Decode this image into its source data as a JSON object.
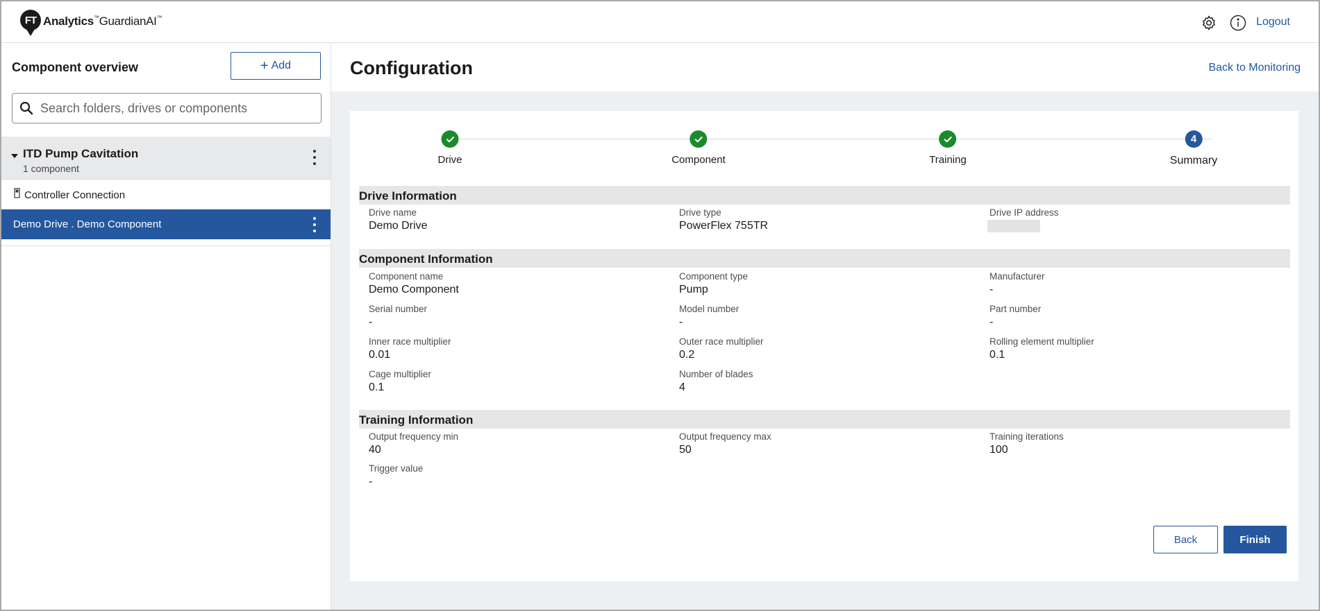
{
  "app": {
    "logo_mark": "FT",
    "logo_bold": "Analytics",
    "logo_product": "GuardianAI",
    "logo_tm": "™",
    "logout_label": "Logout",
    "icons": [
      "gear-icon",
      "info-icon"
    ]
  },
  "sidebar": {
    "title": "Component overview",
    "add_label": "Add",
    "search_placeholder": "Search folders, drives or components",
    "folder": {
      "name": "ITD Pump Cavitation",
      "subtitle": "1 component"
    },
    "items": [
      {
        "label": "Controller Connection",
        "icon": "controller-icon"
      },
      {
        "label": "Demo Drive . Demo Component",
        "selected": true
      }
    ]
  },
  "main": {
    "title": "Configuration",
    "back_link": "Back to Monitoring",
    "steps": [
      {
        "label": "Drive",
        "state": "done"
      },
      {
        "label": "Component",
        "state": "done"
      },
      {
        "label": "Training",
        "state": "done"
      },
      {
        "label": "Summary",
        "state": "active",
        "number": "4"
      }
    ],
    "drive_section": {
      "title": "Drive Information",
      "fields": [
        {
          "label": "Drive name",
          "value": "Demo Drive"
        },
        {
          "label": "Drive type",
          "value": "PowerFlex 755TR"
        },
        {
          "label": "Drive IP address",
          "value": ""
        }
      ]
    },
    "component_section": {
      "title": "Component Information",
      "fields": [
        {
          "label": "Component name",
          "value": "Demo Component"
        },
        {
          "label": "Component type",
          "value": "Pump"
        },
        {
          "label": "Manufacturer",
          "value": "-"
        },
        {
          "label": "Serial number",
          "value": "-"
        },
        {
          "label": "Model number",
          "value": "-"
        },
        {
          "label": "Part number",
          "value": "-"
        },
        {
          "label": "Inner race multiplier",
          "value": "0.01"
        },
        {
          "label": "Outer race multiplier",
          "value": "0.2"
        },
        {
          "label": "Rolling element multiplier",
          "value": "0.1"
        },
        {
          "label": "Cage multiplier",
          "value": "0.1"
        },
        {
          "label": "Number of blades",
          "value": "4"
        }
      ]
    },
    "training_section": {
      "title": "Training Information",
      "fields": [
        {
          "label": "Output frequency min",
          "value": "40"
        },
        {
          "label": "Output frequency max",
          "value": "50"
        },
        {
          "label": "Training iterations",
          "value": "100"
        },
        {
          "label": "Trigger value",
          "value": "-"
        }
      ]
    },
    "back_label": "Back",
    "finish_label": "Finish"
  },
  "colors": {
    "primary": "#24579e",
    "success": "#1c8a2c",
    "section_bg": "#e6e6e6",
    "page_bg": "#edf0f3",
    "folder_bg": "#e8e9eb"
  }
}
